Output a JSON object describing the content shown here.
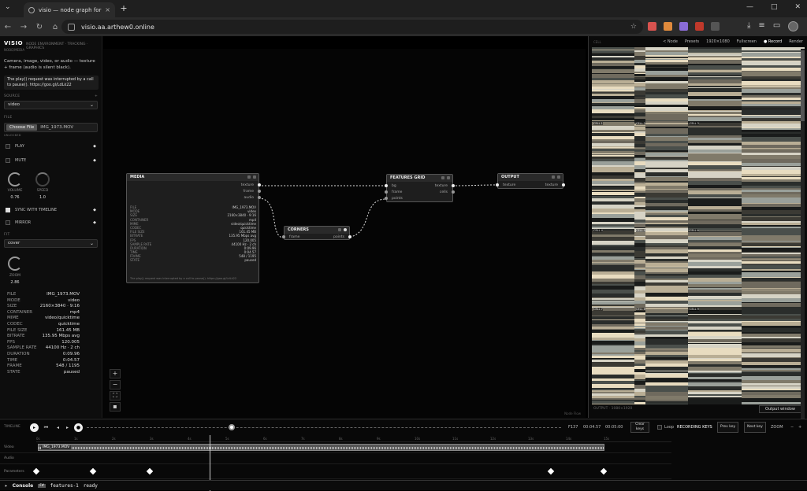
{
  "browser": {
    "tab_title": "visio — node graph for realtim",
    "url": "visio.aa.arthew0.online"
  },
  "app": {
    "brand": "VISIO",
    "nav": "NODE ENVIRONMENT · TRACKING · GRAPHICS",
    "subtitle": "NODE/MEDIA",
    "description": "Camera, image, video, or audio — texture + frame (audio is silent black).",
    "error": "The play() request was interrupted by a call to pause(). https://goo.gl/LdLk22"
  },
  "sidebar": {
    "source_label": "SOURCE",
    "source_value": "video",
    "file_label": "FILE",
    "choose_file": "Choose File",
    "file_name": "IMG_1973.MOV",
    "file_sub": "UNLOCKED",
    "play": "PLAY",
    "mute": "MUTE",
    "volume_label": "VOLUME",
    "volume_value": "0.76",
    "speed_label": "SPEED",
    "speed_value": "1.0",
    "sync": "SYNC WITH TIMELINE",
    "mirror": "MIRROR",
    "fit_label": "FIT",
    "fit_value": "cover",
    "zoom_label": "ZOOM",
    "zoom_value": "2.86",
    "meta": [
      {
        "k": "FILE",
        "v": "IMG_1973.MOV"
      },
      {
        "k": "MODE",
        "v": "video"
      },
      {
        "k": "SIZE",
        "v": "2160×3840 · 9:16"
      },
      {
        "k": "CONTAINER",
        "v": "mp4"
      },
      {
        "k": "MIME",
        "v": "video/quicktime"
      },
      {
        "k": "CODEC",
        "v": "quicktime"
      },
      {
        "k": "FILE SIZE",
        "v": "161.45 MB"
      },
      {
        "k": "BITRATE",
        "v": "135.95 Mbps avg"
      },
      {
        "k": "FPS",
        "v": "120.005"
      },
      {
        "k": "SAMPLE RATE",
        "v": "44100 Hz · 2 ch"
      },
      {
        "k": "DURATION",
        "v": "0:09.96"
      },
      {
        "k": "TIME",
        "v": "0:04.57"
      },
      {
        "k": "FRAME",
        "v": "548 / 1195"
      },
      {
        "k": "STATE",
        "v": "paused"
      }
    ]
  },
  "nodes": {
    "media": {
      "title": "MEDIA",
      "outputs": [
        "texture",
        "frame",
        "audio"
      ],
      "info": [
        {
          "k": "FILE",
          "v": "IMG_1973.MOV"
        },
        {
          "k": "MODE",
          "v": "video"
        },
        {
          "k": "SIZE",
          "v": "2160×3840 · 9:16"
        },
        {
          "k": "CONTAINER",
          "v": "mp4"
        },
        {
          "k": "MIME",
          "v": "video/quicktime"
        },
        {
          "k": "CODEC",
          "v": "quicktime"
        },
        {
          "k": "FILE SIZE",
          "v": "161.45 MB"
        },
        {
          "k": "BITRATE",
          "v": "135.95 Mbps avg"
        },
        {
          "k": "FPS",
          "v": "120.005"
        },
        {
          "k": "SAMPLE RATE",
          "v": "44100 Hz · 2 ch"
        },
        {
          "k": "DURATION",
          "v": "0:09.96"
        },
        {
          "k": "TIME",
          "v": "0:04.57"
        },
        {
          "k": "FRAME",
          "v": "548 / 1195"
        },
        {
          "k": "STATE",
          "v": "paused"
        }
      ],
      "error": "The play() request was interrupted by a call to pause(). https://goo.gl/LdLk22"
    },
    "corners": {
      "title": "CORNERS",
      "input": "frame",
      "output": "points"
    },
    "features": {
      "title": "FEATURES GRID",
      "inputs": [
        "bg",
        "frame",
        "points"
      ],
      "outputs": [
        "texture",
        "cells"
      ]
    },
    "output": {
      "title": "OUTPUT",
      "input": "texture",
      "output": "texture"
    }
  },
  "canvas_footer": "Node Flow",
  "right_panel": {
    "label": "CELL",
    "toolbar": [
      "< Node",
      "Presets",
      "1920×1080",
      "Fullscreen",
      "● Record",
      "Render"
    ],
    "footer": "OUTPUT · 1080×1920",
    "output_window": "Output window",
    "cell_labels": [
      "CELL 1",
      "CELL 2",
      "CELL 3",
      "CELL 4",
      "CELL 5",
      "CELL 6",
      "CELL 7",
      "CELL 8",
      "CELL 9"
    ]
  },
  "timeline": {
    "label": "TIMELINE",
    "frame": "F137",
    "time": "00:04.57",
    "total": "00:05:00",
    "clear": "Clear keys",
    "loop": "Loop",
    "recording": "RECORDING KEYS",
    "prev": "Prev key",
    "next": "Next key",
    "zoom": "ZOOM",
    "ruler": [
      "0s",
      "1s",
      "2s",
      "3s",
      "4s",
      "5s",
      "6s",
      "7s",
      "8s",
      "9s",
      "10s",
      "11s",
      "12s",
      "13s",
      "14s",
      "15s"
    ],
    "tracks": [
      "Video",
      "Audio",
      "Parameters"
    ],
    "clip_name": "IMG_1973.MOV",
    "keyframes_s": [
      0.0,
      1.5,
      3.0,
      13.6,
      15.0
    ]
  },
  "console": {
    "label": "Console",
    "badge": "F#",
    "node": "features-1",
    "status": "ready"
  },
  "colors": {
    "accent": "#ffffff",
    "panel": "#0d0d0d",
    "node": "#1e1e1e"
  }
}
